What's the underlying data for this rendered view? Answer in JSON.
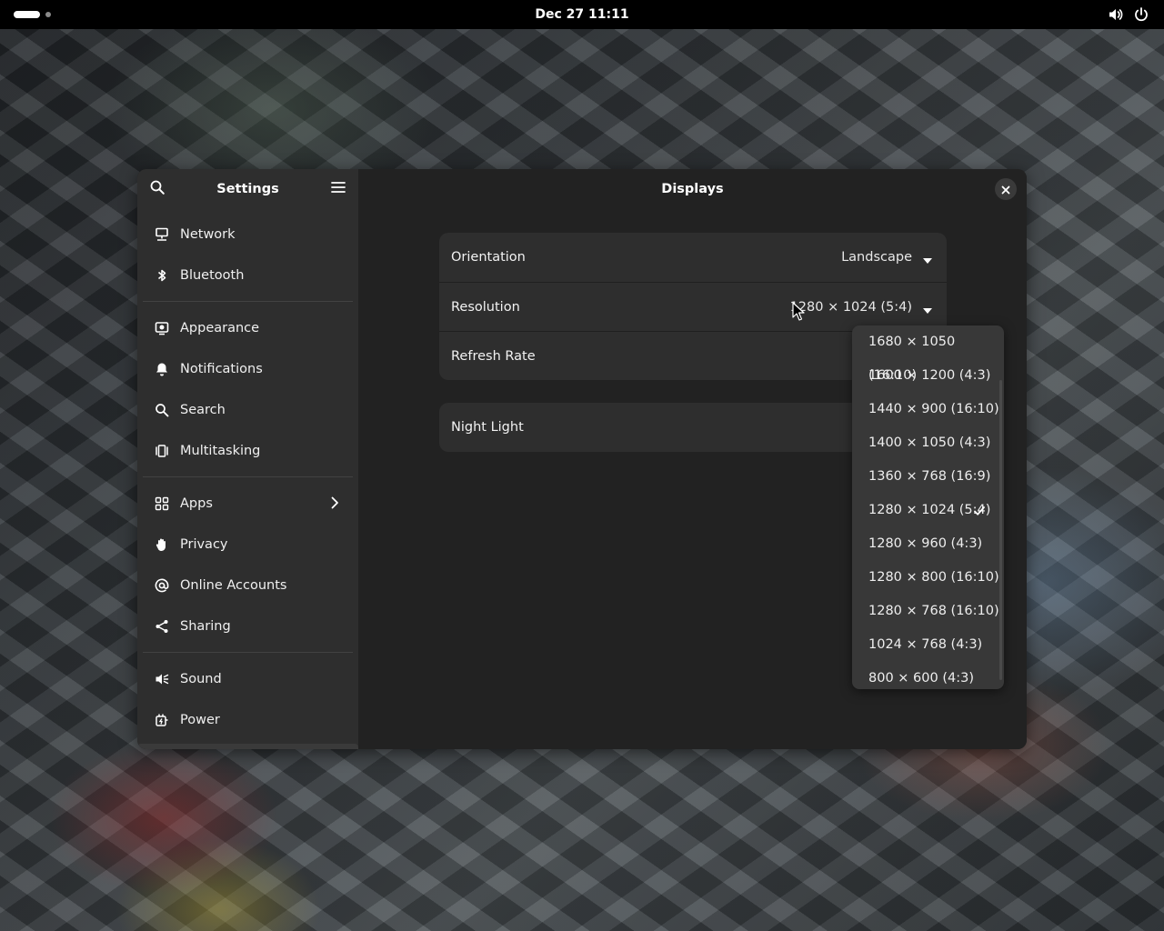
{
  "topbar": {
    "clock": "Dec 27  11:11",
    "icons": [
      "volume-icon",
      "power-icon"
    ]
  },
  "sidebar": {
    "title": "Settings",
    "groups": [
      [
        {
          "label": "Network",
          "icon": "network-icon"
        },
        {
          "label": "Bluetooth",
          "icon": "bluetooth-icon"
        }
      ],
      [
        {
          "label": "Appearance",
          "icon": "appearance-icon"
        },
        {
          "label": "Notifications",
          "icon": "bell-icon"
        },
        {
          "label": "Search",
          "icon": "search-icon"
        },
        {
          "label": "Multitasking",
          "icon": "multitasking-icon"
        }
      ],
      [
        {
          "label": "Apps",
          "icon": "apps-icon",
          "has_chevron": true
        },
        {
          "label": "Privacy",
          "icon": "hand-icon"
        },
        {
          "label": "Online Accounts",
          "icon": "at-icon"
        },
        {
          "label": "Sharing",
          "icon": "share-icon"
        }
      ],
      [
        {
          "label": "Sound",
          "icon": "speaker-icon"
        },
        {
          "label": "Power",
          "icon": "power-plug-icon"
        }
      ]
    ]
  },
  "content": {
    "title": "Displays",
    "rows": {
      "orientation": {
        "label": "Orientation",
        "value": "Landscape"
      },
      "resolution": {
        "label": "Resolution",
        "value": "1280 × 1024 (5:4)"
      },
      "refresh": {
        "label": "Refresh Rate"
      },
      "night_light": {
        "label": "Night Light"
      }
    }
  },
  "resolution_menu": {
    "options": [
      "1680 × 1050 (16:10)",
      "1600 × 1200 (4:3)",
      "1440 × 900 (16:10)",
      "1400 × 1050 (4:3)",
      "1360 × 768 (16:9)",
      "1280 × 1024 (5:4)",
      "1280 × 960 (4:3)",
      "1280 × 800 (16:10)",
      "1280 × 768 (16:10)",
      "1024 × 768 (4:3)",
      "800 × 600 (4:3)"
    ],
    "selected": "1280 × 1024 (5:4)"
  },
  "colors": {
    "window_bg": "#242424",
    "sidebar_bg": "#2e2e2e",
    "card_bg": "#2e2e2e",
    "popover_bg": "#383838",
    "topbar_bg": "#000000"
  }
}
